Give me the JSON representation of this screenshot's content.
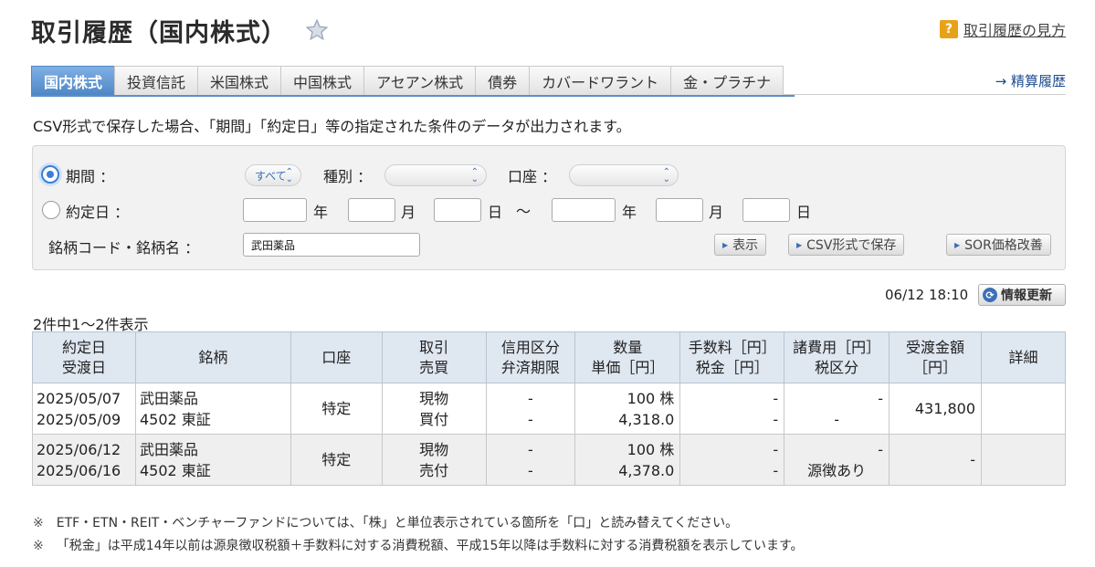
{
  "page": {
    "title": "取引履歴（国内株式）",
    "help_icon": "?",
    "help_link": "取引履歴の見方",
    "settle_link": "→ 精算履歴"
  },
  "tabs": [
    {
      "label": "国内株式",
      "active": true
    },
    {
      "label": "投資信託"
    },
    {
      "label": "米国株式"
    },
    {
      "label": "中国株式"
    },
    {
      "label": "アセアン株式"
    },
    {
      "label": "債券"
    },
    {
      "label": "カバードワラント"
    },
    {
      "label": "金・プラチナ"
    }
  ],
  "notice": "CSV形式で保存した場合、「期間」「約定日」等の指定された条件のデータが出力されます。",
  "filter": {
    "period_label": "期間 ：",
    "period_value": "すべて",
    "type_label": "種別 ：",
    "type_value": "",
    "account_label": "口座 ：",
    "account_value": "",
    "trade_date_label": "約定日 ：",
    "year": "年",
    "month": "月",
    "day": "日",
    "tilde": "〜",
    "symbol_label": "銘柄コード・銘柄名 ：",
    "symbol_value": "武田薬品",
    "show_button": "表示",
    "csv_button": "CSV形式で保存",
    "sor_button": "SOR価格改善"
  },
  "refresh": {
    "time": "06/12 18:10",
    "button": "情報更新"
  },
  "count_text": "2件中1〜2件表示",
  "table": {
    "headers": [
      [
        "約定日",
        "受渡日"
      ],
      [
        "銘柄"
      ],
      [
        "口座"
      ],
      [
        "取引",
        "売買"
      ],
      [
        "信用区分",
        "弁済期限"
      ],
      [
        "数量",
        "単価［円］"
      ],
      [
        "手数料［円］",
        "税金［円］"
      ],
      [
        "諸費用［円］",
        "税区分"
      ],
      [
        "受渡金額",
        "［円］"
      ],
      [
        "詳細"
      ]
    ],
    "rows": [
      {
        "trade_date": "2025/05/07",
        "settle_date": "2025/05/09",
        "name": "武田薬品",
        "code_market": "4502 東証",
        "account": "特定",
        "trade_type": "現物",
        "side": "買付",
        "margin": "-",
        "due": "-",
        "qty": "100 株",
        "price": "4,318.0",
        "fee": "-",
        "tax": "-",
        "expenses": "-",
        "tax_category": "-",
        "amount": "431,800",
        "detail": ""
      },
      {
        "trade_date": "2025/06/12",
        "settle_date": "2025/06/16",
        "name": "武田薬品",
        "code_market": "4502 東証",
        "account": "特定",
        "trade_type": "現物",
        "side": "売付",
        "margin": "-",
        "due": "-",
        "qty": "100 株",
        "price": "4,378.0",
        "fee": "-",
        "tax": "-",
        "expenses": "-",
        "tax_category": "源徴あり",
        "amount": "-",
        "detail": ""
      }
    ]
  },
  "footnotes": [
    {
      "mark": "※",
      "text": "ETF・ETN・REIT・ベンチャーファンドについては、「株」と単位表示されている箇所を「口」と読み替えてください。"
    },
    {
      "mark": "※",
      "text": "「税金」は平成14年以前は源泉徴収税額＋手数料に対する消費税額、平成15年以降は手数料に対する消費税額を表示しています。"
    }
  ],
  "colors": {
    "tab_active": "#4f87c6",
    "link": "#1f4d8f",
    "help_badge": "#e8a21a",
    "header_bg": "#dfe7f1"
  },
  "icons": [
    "star-icon",
    "help-icon",
    "radio-checked-icon",
    "radio-icon",
    "chevron-updown-icon",
    "play-triangle-icon",
    "refresh-icon"
  ]
}
